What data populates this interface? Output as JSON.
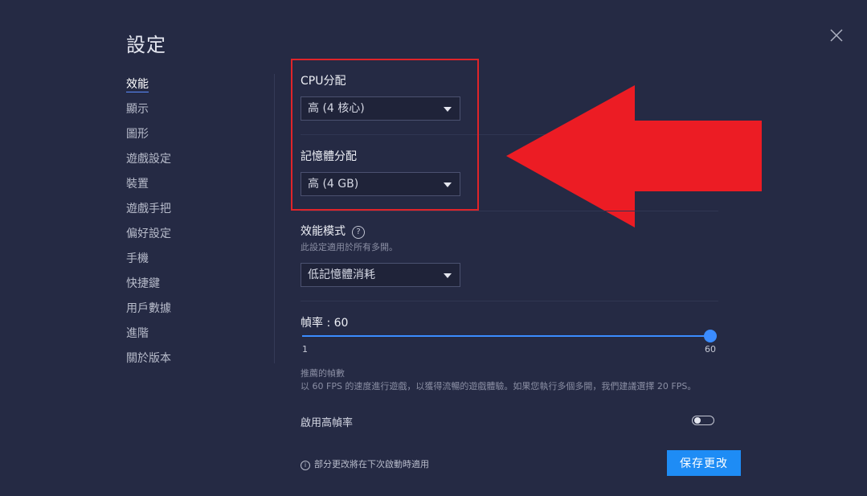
{
  "window": {
    "title": "設定"
  },
  "sidebar": {
    "items": [
      {
        "label": "效能"
      },
      {
        "label": "顯示"
      },
      {
        "label": "圖形"
      },
      {
        "label": "遊戲設定"
      },
      {
        "label": "裝置"
      },
      {
        "label": "遊戲手把"
      },
      {
        "label": "偏好設定"
      },
      {
        "label": "手機"
      },
      {
        "label": "快捷鍵"
      },
      {
        "label": "用戶數據"
      },
      {
        "label": "進階"
      },
      {
        "label": "關於版本"
      }
    ],
    "active_index": 0
  },
  "cpu": {
    "label": "CPU分配",
    "value": "高 (4 核心)"
  },
  "memory": {
    "label": "記憶體分配",
    "value": "高 (4 GB)"
  },
  "performance_mode": {
    "label": "效能模式",
    "help": "?",
    "description": "此設定適用於所有多開。",
    "value": "低記憶體消耗"
  },
  "frame_rate": {
    "label": "幀率 : 60",
    "value": 60,
    "min_label": "1",
    "max_label": "60",
    "recommended_title": "推薦的幀數",
    "recommended_desc": "以 60 FPS 的速度進行遊戲，以獲得流暢的遊戲體驗。如果您執行多個多開，我們建議選擇 20 FPS。",
    "high_fps_label": "啟用高幀率",
    "high_fps_enabled": false
  },
  "footer": {
    "note": "部分更改將在下次啟動時適用",
    "info_icon": "i",
    "save_label": "保存更改"
  },
  "colors": {
    "background": "#252a44",
    "accent": "#1e8cf5",
    "highlight": "#e02429"
  }
}
